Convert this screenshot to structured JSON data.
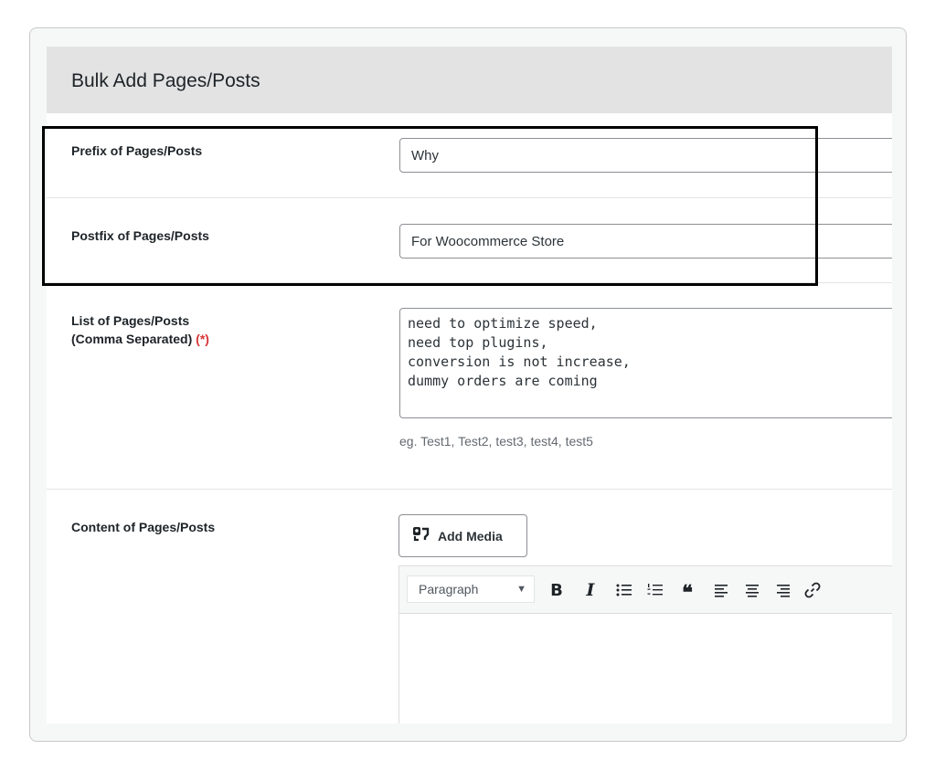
{
  "panel": {
    "title": "Bulk Add Pages/Posts"
  },
  "prefix": {
    "label": "Prefix of Pages/Posts",
    "value": "Why"
  },
  "postfix": {
    "label": "Postfix of Pages/Posts",
    "value": "For Woocommerce Store"
  },
  "list": {
    "label_line1": "List of Pages/Posts",
    "label_line2": "(Comma Separated)",
    "required_marker": "(*)",
    "value": "need to optimize speed,\nneed top plugins,\nconversion is not increase,\ndummy orders are coming",
    "hint": "eg. Test1, Test2, test3, test4, test5"
  },
  "content": {
    "label": "Content of Pages/Posts",
    "add_media_label": "Add Media",
    "format_selected": "Paragraph",
    "toolbar_icons": [
      "bold-icon",
      "italic-icon",
      "bulleted-list-icon",
      "numbered-list-icon",
      "blockquote-icon",
      "align-left-icon",
      "align-center-icon",
      "align-right-icon",
      "link-icon"
    ],
    "toolbar_glyphs": {
      "bold": "B",
      "italic": "I",
      "blockquote": "❝"
    }
  },
  "colors": {
    "required": "#d63638",
    "header_bg": "#e3e3e3",
    "annotation_box": "#000000"
  }
}
